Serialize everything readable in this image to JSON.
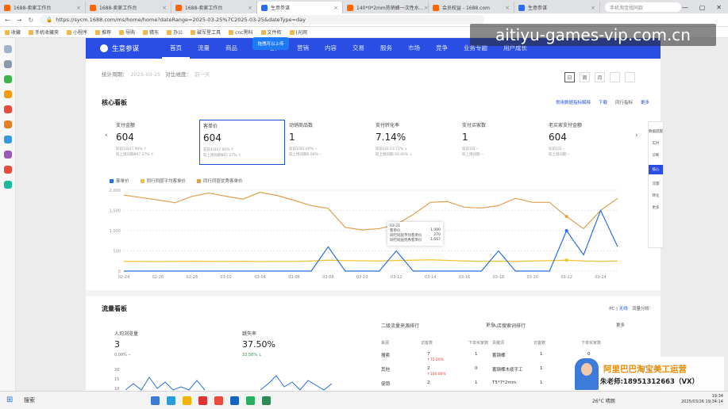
{
  "watermark": "aitiyu-games-vip.com.cn",
  "browser": {
    "tabs": [
      {
        "label": "1688-卖家工作台",
        "color": "#ff6600"
      },
      {
        "label": "1688-卖家工作台",
        "color": "#ff6600"
      },
      {
        "label": "1688-卖家工作台",
        "color": "#ff6600"
      },
      {
        "label": "生意参谋",
        "color": "#2d6df6",
        "active": true
      },
      {
        "label": "140*0*2mm热销蜂一次性水…",
        "color": "#ff6600"
      },
      {
        "label": "会员权益 - 1688.com",
        "color": "#ff6600"
      },
      {
        "label": "生意参谋",
        "color": "#2d6df6"
      }
    ],
    "tab_search": "手机淘宝找同款",
    "url": "https://sycm.1688.com/ms/home/home?dateRange=2025-03-25%7C2025-03-25&dateType=day",
    "bookmarks": [
      "收藏",
      "手机收藏夹",
      "小程序",
      "推荐",
      "导购",
      "猜东",
      "办公",
      "破军星工具",
      "cnc黑科",
      "文件柜",
      "(光网"
    ]
  },
  "app": {
    "logo": "生意参谋",
    "nav": [
      "首页",
      "流量",
      "商品",
      "",
      "客户",
      "营销",
      "内容",
      "交易",
      "服务",
      "市场",
      "竞争",
      "业务专题",
      "用户成长"
    ],
    "nav_active": 0,
    "upload_badge": "拖拽可以上传"
  },
  "header": {
    "period_label": "统计周期：",
    "period": "2025-03-25",
    "compare_label": "对比维度：",
    "compare": "前一天",
    "day_buttons": [
      "日",
      "周",
      "月",
      "",
      ""
    ]
  },
  "core": {
    "title": "核心看板",
    "links": [
      "常用数据指标解释",
      "下载",
      "同行指标",
      "更多"
    ],
    "metrics": [
      {
        "label": "支付金额",
        "value": "604",
        "sub1": "较前1日47.90% ↑",
        "sub2": "较上周同期897.27% ↑"
      },
      {
        "label": "客单价",
        "value": "604",
        "sub1": "较前1日47.90% ↑",
        "sub2": "较上周同期897.27% ↑",
        "selected": true
      },
      {
        "label": "动销商品数",
        "value": "1",
        "sub1": "较前1日0.00% --",
        "sub2": "较上周同期0.00% --"
      },
      {
        "label": "支付转化率",
        "value": "7.14%",
        "sub1": "较前1日-23.71% ↓",
        "sub2": "较上周同期-50.00% ↓"
      },
      {
        "label": "支付买家数",
        "value": "1",
        "sub1": "较前1日 --",
        "sub2": "较上周同期 --"
      },
      {
        "label": "老买家支付金额",
        "value": "604",
        "sub1": "较前1日 --",
        "sub2": "较上周同期 --"
      }
    ],
    "side": [
      "数据提醒",
      "实时",
      "诊断",
      "核心",
      "流量",
      "转化",
      "更多"
    ]
  },
  "chart_data": {
    "type": "line",
    "title": "",
    "legend": [
      "客单价",
      "同行同层平均客单价",
      "同行同层优秀客单价"
    ],
    "x": [
      "02-24",
      "02-25",
      "02-26",
      "02-27",
      "02-28",
      "03-01",
      "03-02",
      "03-03",
      "03-04",
      "03-05",
      "03-06",
      "03-07",
      "03-08",
      "03-09",
      "03-10",
      "03-11",
      "03-12",
      "03-13",
      "03-14",
      "03-15",
      "03-16",
      "03-17",
      "03-18",
      "03-19",
      "03-20",
      "03-21",
      "03-22",
      "03-23",
      "03-24",
      "03-25"
    ],
    "ylim": [
      0,
      2000
    ],
    "yticks": [
      "2,000",
      "1,500",
      "1,000",
      "500",
      "0"
    ],
    "series": [
      {
        "name": "客单价",
        "color": "#2a6fdd",
        "values": [
          0,
          0,
          0,
          0,
          0,
          0,
          0,
          0,
          0,
          0,
          0,
          0,
          600,
          0,
          0,
          0,
          500,
          0,
          0,
          0,
          0,
          0,
          500,
          0,
          0,
          0,
          1000,
          400,
          1500,
          604
        ]
      },
      {
        "name": "同行同层平均客单价",
        "color": "#f2c530",
        "values": [
          240,
          240,
          235,
          240,
          245,
          240,
          238,
          242,
          236,
          240,
          238,
          250,
          270,
          260,
          255,
          250,
          262,
          270,
          280,
          265,
          250,
          240,
          245,
          240,
          250,
          260,
          270,
          250,
          240,
          250
        ]
      },
      {
        "name": "同行同层优秀客单价",
        "color": "#e0a050",
        "values": [
          1880,
          1820,
          1760,
          1690,
          1850,
          1930,
          1850,
          1780,
          1950,
          1870,
          1750,
          1620,
          1550,
          1080,
          1020,
          1050,
          1150,
          1400,
          1700,
          1720,
          1580,
          1560,
          1620,
          1800,
          1700,
          1700,
          1350,
          1050,
          1500,
          1800
        ]
      }
    ],
    "tooltip": {
      "date": "03-21",
      "rows": [
        [
          "客单价",
          "1,000"
        ],
        [
          "同行同层平均客单价",
          "270"
        ],
        [
          "同行同层优秀客单价",
          "1,667"
        ]
      ]
    }
  },
  "flow": {
    "title": "流量看板",
    "pc_label": "PC",
    "wireless": "无线",
    "analysis": "流量分析",
    "visitors_label": "人均浏览量",
    "visitors": "3",
    "visitors_sub": "0.00% --",
    "bounce_label": "跳失率",
    "bounce": "37.50%",
    "bounce_sub": "33.50% ↓",
    "yticks": [
      "20",
      "15",
      "10",
      "5"
    ],
    "src_title": "二级流量来源排行",
    "src_more": "更多",
    "src_cols": [
      "来源",
      "访客数",
      "下单买家数"
    ],
    "src_rows": [
      [
        "搜索",
        "7",
        "↑75.00%",
        "1"
      ],
      [
        "其他",
        "2",
        "↑100.00%",
        "0"
      ],
      [
        "促销",
        "2",
        "",
        "1"
      ]
    ],
    "kw_title": "入店搜索词排行",
    "kw_more": "更多",
    "kw_cols": [
      "关键词",
      "访客数",
      "下单买家数"
    ],
    "kw_rows": [
      [
        "蓄钢椰",
        "1",
        "0"
      ],
      [
        "蓄钢椰木缆手工",
        "1",
        "0"
      ],
      [
        "T5*7*2mm",
        "1",
        "0"
      ]
    ]
  },
  "ad": {
    "title": "阿里巴巴淘宝美工运营",
    "sub": "朱老师:18951312663（VX）"
  },
  "taskbar": {
    "search": "搜索",
    "weather": "26°C 晴朗",
    "time": "19:34",
    "date": "2025/03/26 19:34:14"
  }
}
